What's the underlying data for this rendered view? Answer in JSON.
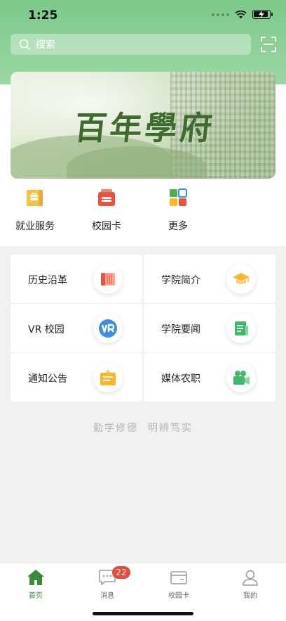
{
  "status": {
    "time": "1:25"
  },
  "search": {
    "placeholder": "搜索"
  },
  "quick_menu": [
    {
      "label": "就业服务",
      "icon": "briefcase-icon",
      "color": "#f5c342"
    },
    {
      "label": "校园卡",
      "icon": "card-wallet-icon",
      "color": "#e8533e"
    },
    {
      "label": "更多",
      "icon": "grid-apps-icon",
      "color": "#4caf50"
    }
  ],
  "grid": [
    {
      "label": "历史沿革",
      "icon": "scroll-icon",
      "color": "#e8533e"
    },
    {
      "label": "学院简介",
      "icon": "graduation-cap-icon",
      "color": "#f5b82e"
    },
    {
      "label": "VR 校园",
      "icon": "vr-icon",
      "color": "#3b8ee8"
    },
    {
      "label": "学院要闻",
      "icon": "news-icon",
      "color": "#3fba6b"
    },
    {
      "label": "通知公告",
      "icon": "notice-board-icon",
      "color": "#f5b82e"
    },
    {
      "label": "媒体农职",
      "icon": "video-camera-icon",
      "color": "#3fba6b"
    }
  ],
  "motto": [
    "勤学修德",
    "明辨笃实"
  ],
  "tabbar": [
    {
      "label": "首页",
      "icon": "home-icon",
      "active": true
    },
    {
      "label": "消息",
      "icon": "message-icon",
      "active": false,
      "badge": "22"
    },
    {
      "label": "校园卡",
      "icon": "card-icon",
      "active": false
    },
    {
      "label": "我的",
      "icon": "user-icon",
      "active": false
    }
  ],
  "colors": {
    "accent": "#3d8a3a",
    "header": "#7cc98a",
    "badge": "#e64b3b"
  }
}
